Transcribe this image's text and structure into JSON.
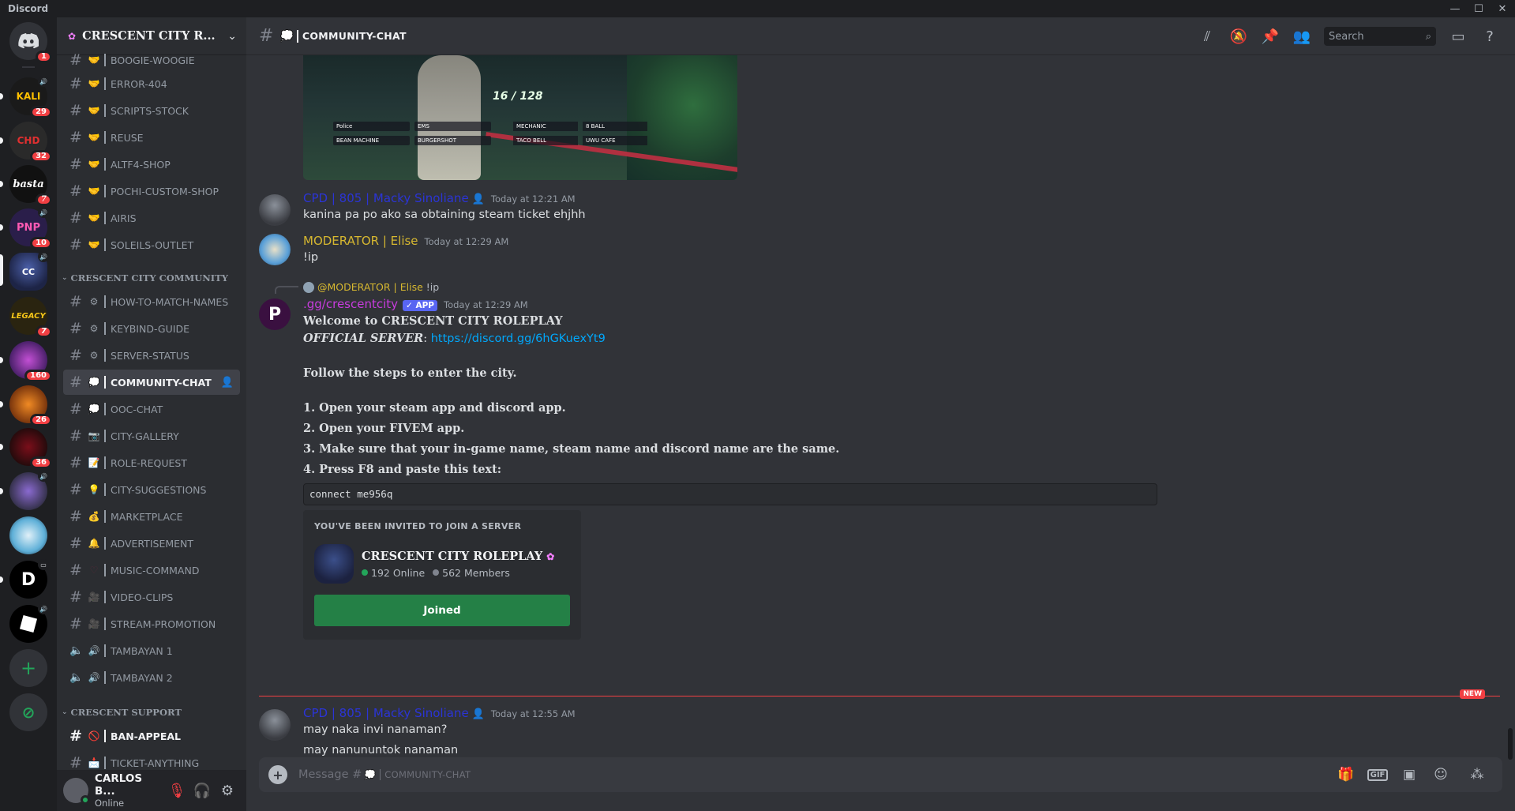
{
  "app": {
    "title": "Discord"
  },
  "window": {
    "minimize": "—",
    "maximize": "☐",
    "close": "✕"
  },
  "rail": {
    "home_badge": "1",
    "servers": [
      {
        "label": "KALI",
        "badge": "29"
      },
      {
        "label": "CHD",
        "badge": "32"
      },
      {
        "label": "basta",
        "badge": "7"
      },
      {
        "label": "PNP",
        "badge": "10"
      },
      {
        "label": "CC",
        "badge": ""
      },
      {
        "label": "LEGACY",
        "badge": "7"
      },
      {
        "label": "",
        "badge": "160"
      },
      {
        "label": "",
        "badge": "26"
      },
      {
        "label": "",
        "badge": "36"
      },
      {
        "label": "",
        "badge": ""
      },
      {
        "label": "",
        "badge": ""
      },
      {
        "label": "D",
        "badge": ""
      },
      {
        "label": "",
        "badge": ""
      }
    ],
    "add_label": "+",
    "discover_label": "⊘"
  },
  "guild": {
    "name": "CRESCENT CITY R...",
    "icon": "flower-icon"
  },
  "channels": [
    {
      "emoji": "🤝",
      "name": "BOOGIE-WOOGIE"
    },
    {
      "emoji": "🤝",
      "name": "ERROR-404"
    },
    {
      "emoji": "🤝",
      "name": "SCRIPTS-STOCK"
    },
    {
      "emoji": "🤝",
      "name": "REUSE"
    },
    {
      "emoji": "🤝",
      "name": "ALTF4-SHOP"
    },
    {
      "emoji": "🤝",
      "name": "POCHI-CUSTOM-SHOP"
    },
    {
      "emoji": "🤝",
      "name": "AIRIS"
    },
    {
      "emoji": "🤝",
      "name": "SOLEILS-OUTLET"
    }
  ],
  "categories": {
    "community": "CRESCENT CITY COMMUNITY",
    "support": "CRESCENT SUPPORT"
  },
  "community_channels": [
    {
      "emoji": "⚙",
      "name": "HOW-TO-MATCH-NAMES"
    },
    {
      "emoji": "⚙",
      "name": "KEYBIND-GUIDE"
    },
    {
      "emoji": "⚙",
      "name": "SERVER-STATUS"
    },
    {
      "emoji": "💭",
      "name": "COMMUNITY-CHAT"
    },
    {
      "emoji": "💭",
      "name": "OOC-CHAT"
    },
    {
      "emoji": "📷",
      "name": "CITY-GALLERY"
    },
    {
      "emoji": "📝",
      "name": "ROLE-REQUEST"
    },
    {
      "emoji": "💡",
      "name": "CITY-SUGGESTIONS"
    },
    {
      "emoji": "💰",
      "name": "MARKETPLACE"
    },
    {
      "emoji": "🔔",
      "name": "ADVERTISEMENT"
    },
    {
      "emoji": "♡",
      "name": "MUSIC-COMMAND"
    },
    {
      "emoji": "🎥",
      "name": "VIDEO-CLIPS"
    },
    {
      "emoji": "🎥",
      "name": "STREAM-PROMOTION"
    },
    {
      "emoji": "🔊",
      "name": "TAMBAYAN 1"
    },
    {
      "emoji": "🔊",
      "name": "TAMBAYAN 2"
    }
  ],
  "support_channels": [
    {
      "emoji": "🚫",
      "name": "BAN-APPEAL"
    },
    {
      "emoji": "📩",
      "name": "TICKET-ANYTHING"
    }
  ],
  "user": {
    "name": "CARLOS B...",
    "status": "Online"
  },
  "header": {
    "channel_emoji": "💭",
    "channel": "COMMUNITY-CHAT",
    "search_placeholder": "Search"
  },
  "image": {
    "counter": "16 / 128",
    "labels": [
      "Police",
      "EMS",
      "MECHANIC",
      "8 BALL",
      "BEAN MACHINE",
      "BURGERSHOT",
      "TACO BELL",
      "UWU CAFE"
    ]
  },
  "messages": {
    "m1": {
      "author": "CPD | 805 | Macky Sinoliane",
      "author_color": "#2b34d6",
      "time": "Today at 12:21 AM",
      "text": "kanina pa po ako sa obtaining steam ticket ehjhh"
    },
    "m2": {
      "author": "MODERATOR | Elise",
      "author_color": "#d7b830",
      "time": "Today at 12:29 AM",
      "text": "!ip"
    },
    "m3": {
      "reply_name": "@MODERATOR | Elise",
      "reply_text": "!ip",
      "author": ".gg/crescentcity",
      "author_color": "#c83cde",
      "tag": "✓ APP",
      "time": "Today at 12:29 AM",
      "l1": "Welcome to CRESCENT CITY ROLEPLAY",
      "l2_label": "OFFICIAL SERVER",
      "l2_sep": ": ",
      "l2_link": "https://discord.gg/6hGKuexYt9",
      "l3": "Follow the steps to enter the city.",
      "s1": "1. Open your steam app and discord app.",
      "s2": "2. Open your FIVEM app.",
      "s3": "3. Make sure that your in-game name, steam name and discord name are the same.",
      "s4": "4. Press F8 and paste this text:",
      "code": "connect me956q"
    },
    "invite": {
      "title": "YOU'VE BEEN INVITED TO JOIN A SERVER",
      "name": "CRESCENT CITY ROLEPLAY",
      "online": "192 Online",
      "members": "562 Members",
      "button": "Joined"
    },
    "new_label": "NEW",
    "m4": {
      "author": "CPD | 805 | Macky Sinoliane",
      "author_color": "#2b34d6",
      "time": "Today at 12:55 AM",
      "text1": "may naka invi nanaman?",
      "text2": "may nanununtok nanaman"
    }
  },
  "composer": {
    "placeholder": "Message #",
    "emoji": "💭",
    "channel": "COMMUNITY-CHAT"
  }
}
